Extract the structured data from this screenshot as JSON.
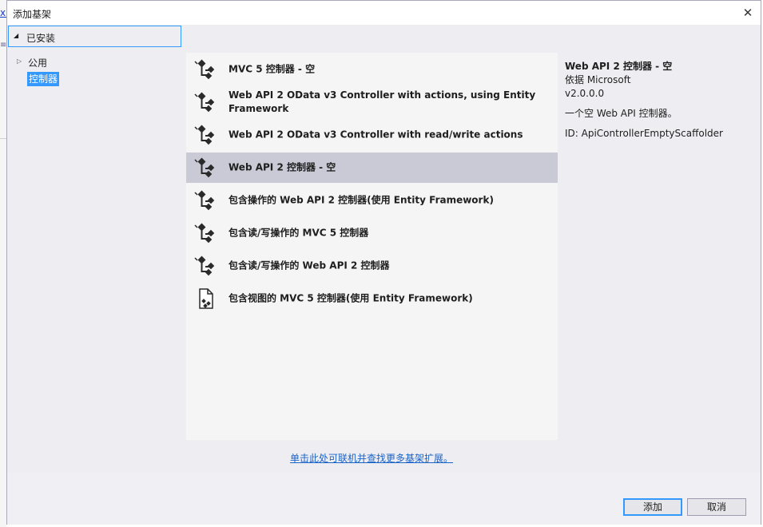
{
  "background": {
    "link_fragment": "xm",
    "glyph_fragment": "≡"
  },
  "dialog": {
    "title": "添加基架",
    "close_glyph": "✕"
  },
  "tree": {
    "installed": "已安装",
    "public": "公用",
    "controller": "控制器"
  },
  "items": [
    {
      "label": "MVC 5 控制器 - 空",
      "icon": "controller-icon"
    },
    {
      "label": "Web API 2 OData v3 Controller with actions, using Entity Framework",
      "icon": "controller-icon"
    },
    {
      "label": "Web API 2 OData v3 Controller with read/write actions",
      "icon": "controller-icon"
    },
    {
      "label": "Web API 2 控制器 - 空",
      "icon": "controller-icon",
      "selected": true
    },
    {
      "label": "包含操作的 Web API 2 控制器(使用 Entity Framework)",
      "icon": "controller-icon"
    },
    {
      "label": "包含读/写操作的 MVC 5 控制器",
      "icon": "controller-icon"
    },
    {
      "label": "包含读/写操作的 Web API 2 控制器",
      "icon": "controller-icon"
    },
    {
      "label": "包含视图的 MVC 5 控制器(使用 Entity Framework)",
      "icon": "view-page-icon"
    }
  ],
  "details": {
    "title": "Web API 2 控制器 - 空",
    "author": "依据 Microsoft",
    "version": "v2.0.0.0",
    "description": "一个空 Web API 控制器。",
    "id": "ID: ApiControllerEmptyScaffolder"
  },
  "online_link": "单击此处可联机并查找更多基架扩展。",
  "buttons": {
    "add": "添加",
    "cancel": "取消"
  },
  "colors": {
    "selection": "#cacad6",
    "accent": "#3399ff",
    "link": "#1a63c7"
  }
}
